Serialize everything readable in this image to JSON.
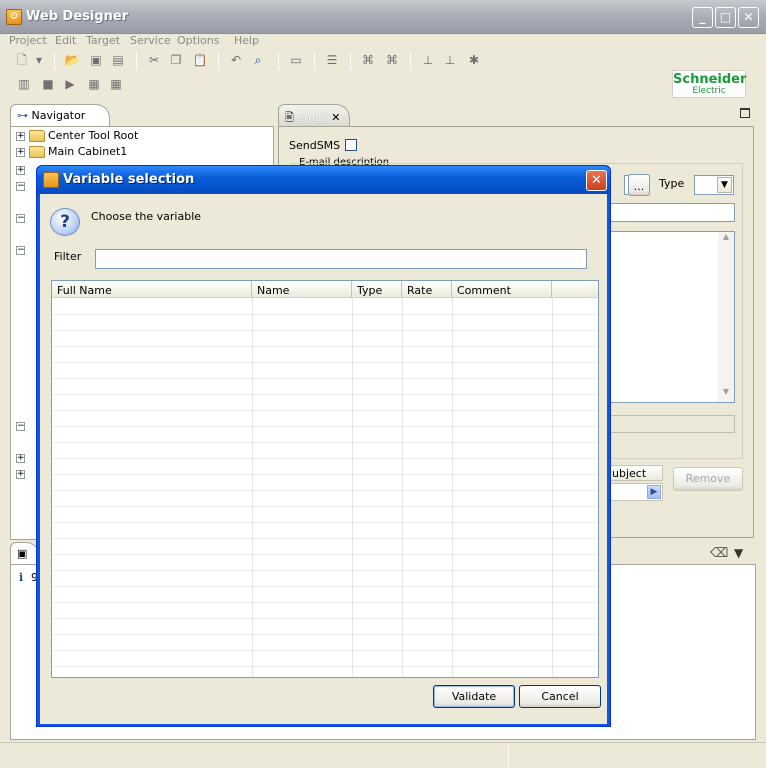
{
  "window": {
    "title": "Web Designer",
    "minimize": "_",
    "maximize": "□",
    "close": "✕"
  },
  "menu": [
    "Project",
    "Edit",
    "Target",
    "Service",
    "Options",
    "Help"
  ],
  "brand": {
    "line1": "Schneider",
    "line2": "Electric"
  },
  "navigator": {
    "tab_label": "Navigator",
    "items": [
      "Center Tool Root",
      "Main Cabinet1"
    ]
  },
  "editor": {
    "tab_label": "email",
    "sendsms_label": "SendSMS",
    "email_description_label": "E-mail description",
    "type_label": "Type",
    "browse_label": "...",
    "subject_label": "ubject",
    "remove_label": "Remove"
  },
  "console": {
    "info_text": "9"
  },
  "dialog": {
    "title": "Variable selection",
    "prompt": "Choose the variable",
    "filter_label": "Filter",
    "filter_value": "",
    "columns": [
      "Full Name",
      "Name",
      "Type",
      "Rate",
      "Comment"
    ],
    "validate_label": "Validate",
    "cancel_label": "Cancel"
  }
}
